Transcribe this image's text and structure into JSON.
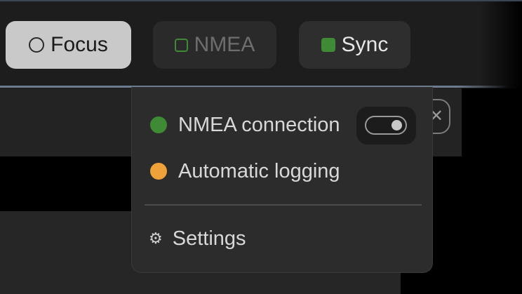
{
  "toolbar": {
    "chips": [
      {
        "label": "Focus",
        "icon": "circle-outline-icon"
      },
      {
        "label": "NMEA",
        "icon": "square-outline-icon"
      },
      {
        "label": "Sync",
        "icon": "square-filled-icon"
      }
    ]
  },
  "popover": {
    "items": [
      {
        "label": "NMEA connection",
        "status_color": "#3f8a34"
      },
      {
        "label": "Automatic logging",
        "status_color": "#f0a23a"
      }
    ],
    "toggle": {
      "state": "on"
    },
    "settings_label": "Settings",
    "settings_icon": "gear-icon"
  },
  "colors": {
    "accent_green": "#3f8a34",
    "accent_orange": "#f0a23a",
    "background": "#000000",
    "panel": "#2c2c2c"
  }
}
